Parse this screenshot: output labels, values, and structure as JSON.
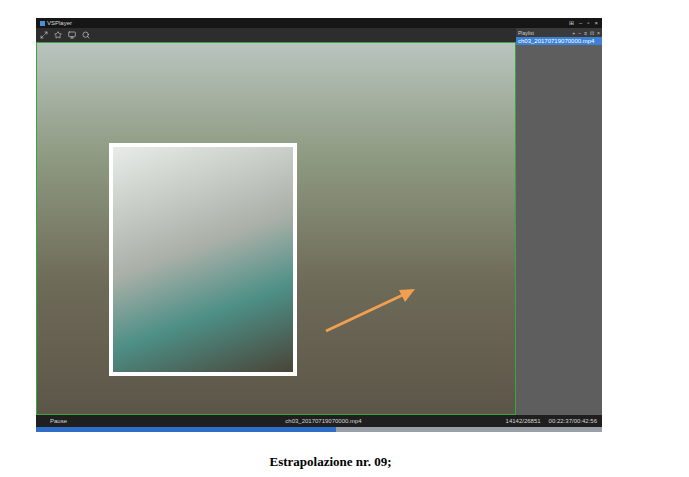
{
  "window": {
    "title": "VSPlayer",
    "controls": [
      "⊞",
      "–",
      "▫",
      "×"
    ]
  },
  "playlist": {
    "title": "Playlist",
    "controls": [
      "+",
      "−",
      "≡",
      "⊡",
      "×"
    ],
    "items": [
      {
        "name": "ch03_20170719070000.mp4",
        "selected": true
      }
    ]
  },
  "status_bar": {
    "state": "Pause",
    "file": "ch03_20170719070000.mp4",
    "frames": "14142/26851",
    "time": "00:22:37/00:42:56"
  },
  "progress": {
    "level": 0.53
  },
  "caption": "Estrapolazione nr. 09;"
}
